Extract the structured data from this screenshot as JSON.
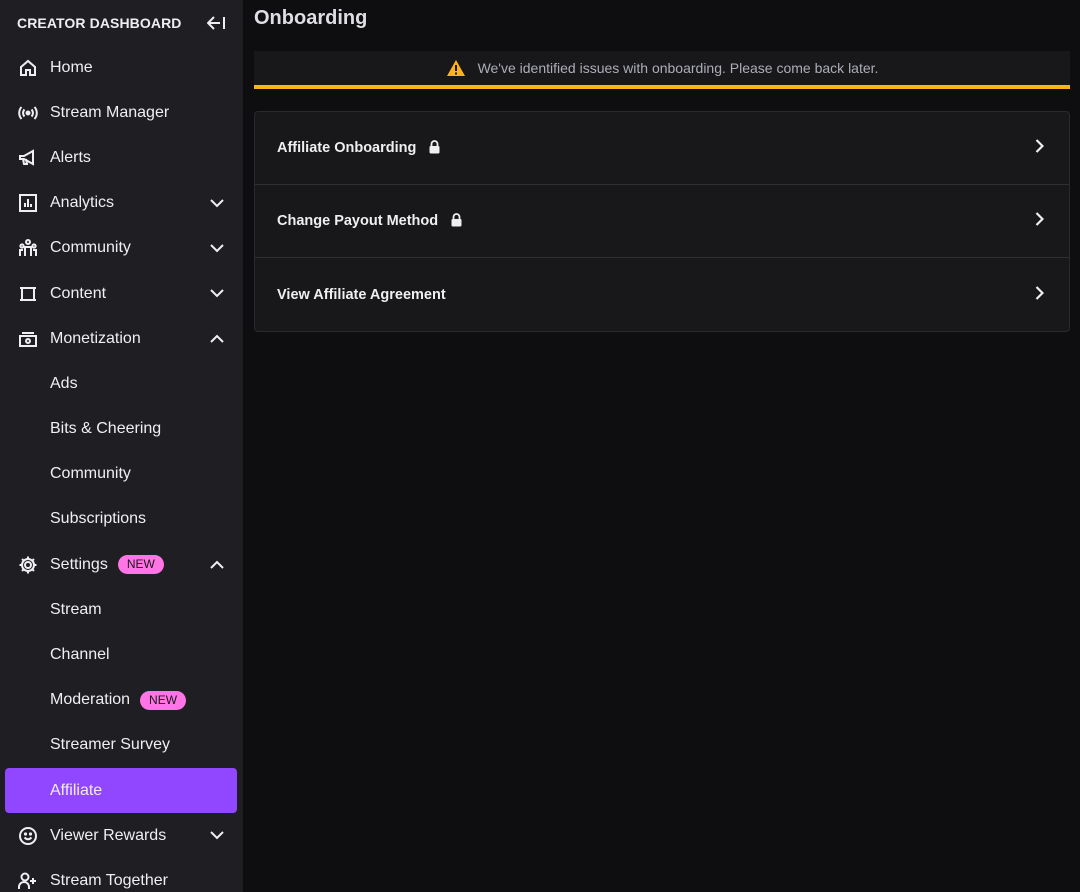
{
  "sidebar": {
    "title": "CREATOR DASHBOARD",
    "items": [
      {
        "label": "Home",
        "icon": "home-icon"
      },
      {
        "label": "Stream Manager",
        "icon": "broadcast-icon"
      },
      {
        "label": "Alerts",
        "icon": "megaphone-icon"
      },
      {
        "label": "Analytics",
        "icon": "analytics-icon",
        "expanded": false
      },
      {
        "label": "Community",
        "icon": "community-icon",
        "expanded": false
      },
      {
        "label": "Content",
        "icon": "content-icon",
        "expanded": false
      },
      {
        "label": "Monetization",
        "icon": "monetization-icon",
        "expanded": true
      },
      {
        "label": "Ads"
      },
      {
        "label": "Bits & Cheering"
      },
      {
        "label": "Community"
      },
      {
        "label": "Subscriptions"
      },
      {
        "label": "Settings",
        "icon": "gear-icon",
        "badge": "NEW",
        "expanded": true
      },
      {
        "label": "Stream"
      },
      {
        "label": "Channel"
      },
      {
        "label": "Moderation",
        "badge": "NEW"
      },
      {
        "label": "Streamer Survey"
      },
      {
        "label": "Affiliate",
        "active": true
      },
      {
        "label": "Viewer Rewards",
        "icon": "smiley-icon",
        "expanded": false
      },
      {
        "label": "Stream Together",
        "icon": "add-user-icon"
      }
    ]
  },
  "main": {
    "title": "Onboarding",
    "banner": "We've identified issues with onboarding. Please come back later.",
    "rows": [
      {
        "label": "Affiliate Onboarding",
        "locked": true
      },
      {
        "label": "Change Payout Method",
        "locked": true
      },
      {
        "label": "View Affiliate Agreement",
        "locked": false
      }
    ]
  },
  "colors": {
    "accent": "#9147ff",
    "warning": "#ffb31a",
    "badge": "#ff75e6",
    "sidebar_bg": "#1f1f23",
    "page_bg": "#0e0e10"
  }
}
